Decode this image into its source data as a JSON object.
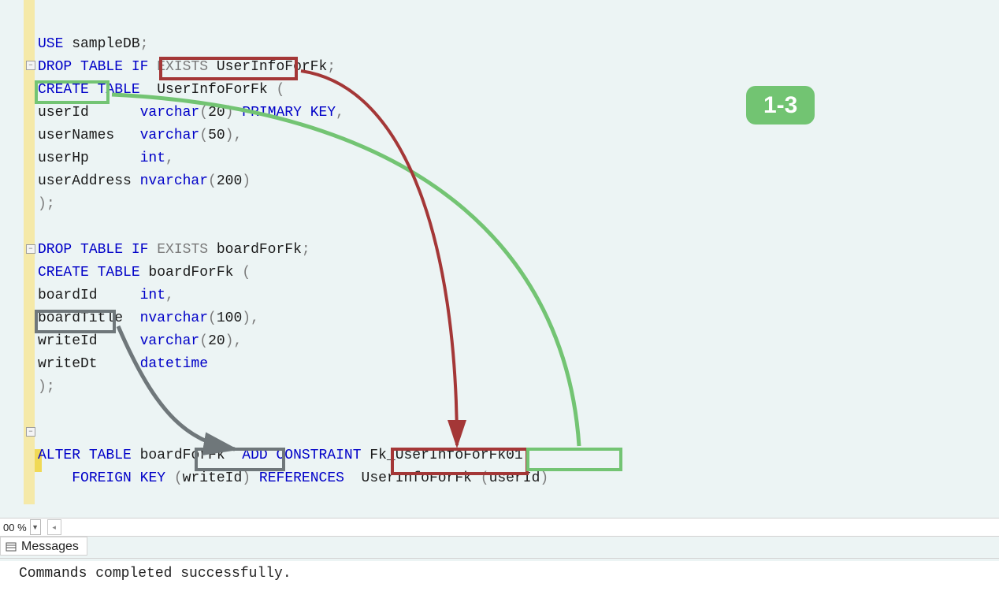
{
  "badge": "1-3",
  "zoom": "00 %",
  "messages_tab": "Messages",
  "result_text": "Commands completed successfully.",
  "code": {
    "l01": {
      "a": "USE",
      "b": " sampleDB",
      "c": ";"
    },
    "l02": {
      "a": "DROP",
      "b": " TABLE",
      "c": " IF",
      "d": " EXISTS",
      "e": " UserInfoForFk",
      "f": ";"
    },
    "l03": {
      "a": "CREATE",
      "b": " TABLE",
      "c": "  UserInfoForFk ",
      "d": "("
    },
    "l04": {
      "a": "userId      ",
      "b": "varchar",
      "c": "(",
      "d": "20",
      "e": ")",
      "f": " PRIMARY",
      "g": " KEY",
      "h": ","
    },
    "l05": {
      "a": "userNames   ",
      "b": "varchar",
      "c": "(",
      "d": "50",
      "e": ")",
      "f": ","
    },
    "l06": {
      "a": "userHp      ",
      "b": "int",
      "c": ","
    },
    "l07": {
      "a": "userAddress ",
      "b": "nvarchar",
      "c": "(",
      "d": "200",
      "e": ")"
    },
    "l08": {
      "a": ")",
      "b": ";"
    },
    "l09": {
      "a": ""
    },
    "l10": {
      "a": "DROP",
      "b": " TABLE",
      "c": " IF",
      "d": " EXISTS",
      "e": " boardForFk",
      "f": ";"
    },
    "l11": {
      "a": "CREATE",
      "b": " TABLE",
      "c": " boardForFk ",
      "d": "("
    },
    "l12": {
      "a": "boardId     ",
      "b": "int",
      "c": ","
    },
    "l13": {
      "a": "boardTitle  ",
      "b": "nvarchar",
      "c": "(",
      "d": "100",
      "e": ")",
      "f": ","
    },
    "l14": {
      "a": "writeId     ",
      "b": "varchar",
      "c": "(",
      "d": "20",
      "e": ")",
      "f": ","
    },
    "l15": {
      "a": "writeDt     ",
      "b": "datetime"
    },
    "l16": {
      "a": ")",
      "b": ";"
    },
    "l17": {
      "a": ""
    },
    "l18": {
      "a": ""
    },
    "l19": {
      "a": "ALTER",
      "b": " TABLE",
      "c": " boardForFk  ",
      "d": "ADD",
      "e": " CONSTRAINT",
      "f": " Fk_UserInfoForFk01"
    },
    "l20": {
      "a": "    ",
      "b": "FOREIGN",
      "c": " KEY",
      "d": " (",
      "e": "writeId",
      "f": ")",
      "g": " REFERENCES",
      "h": "  UserInfoForFk ",
      "i": "(",
      "j": "userId",
      "k": ")"
    }
  },
  "annotations": {
    "table_name_top_box_color": "#a43737",
    "userId_box_color": "#73c473",
    "writeId_box_color": "#6f777a",
    "writeId_bottom_box_color": "#6f777a",
    "userInfo_bottom_box_color": "#a43737",
    "userId_bottom_box_color": "#73c473"
  }
}
